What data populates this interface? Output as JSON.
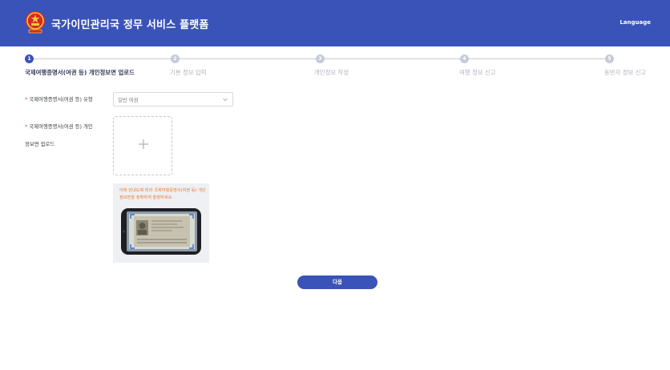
{
  "header": {
    "title": "국가이민관리국 정무 서비스 플랫폼",
    "language_label": "Language",
    "emblem_icon": "national-emblem-icon"
  },
  "steps": [
    {
      "number": "1",
      "label": "국제여행증명서(여권 등) 개인정보면 업로드",
      "active": true
    },
    {
      "number": "2",
      "label": "기본 정보 입력",
      "active": false
    },
    {
      "number": "3",
      "label": "개인정보 작성",
      "active": false
    },
    {
      "number": "4",
      "label": "여행 정보 신고",
      "active": false
    },
    {
      "number": "5",
      "label": "동반자 정보 신고",
      "active": false
    }
  ],
  "form": {
    "document_type_label": "국제여행증명서(여권 등) 유형",
    "document_type_value": "일반 여권",
    "upload_label": "국제여행증명서(여권 등) 개인정보면 업로드"
  },
  "guide": {
    "text": "아래 안내도에 따라 국제여행증명서(여권 등) 개인정보면을 정확하게 촬영하세요"
  },
  "actions": {
    "next_label": "다음"
  },
  "colors": {
    "primary": "#3a53b8",
    "required": "#e04646",
    "guide_text": "#f07a2a"
  }
}
